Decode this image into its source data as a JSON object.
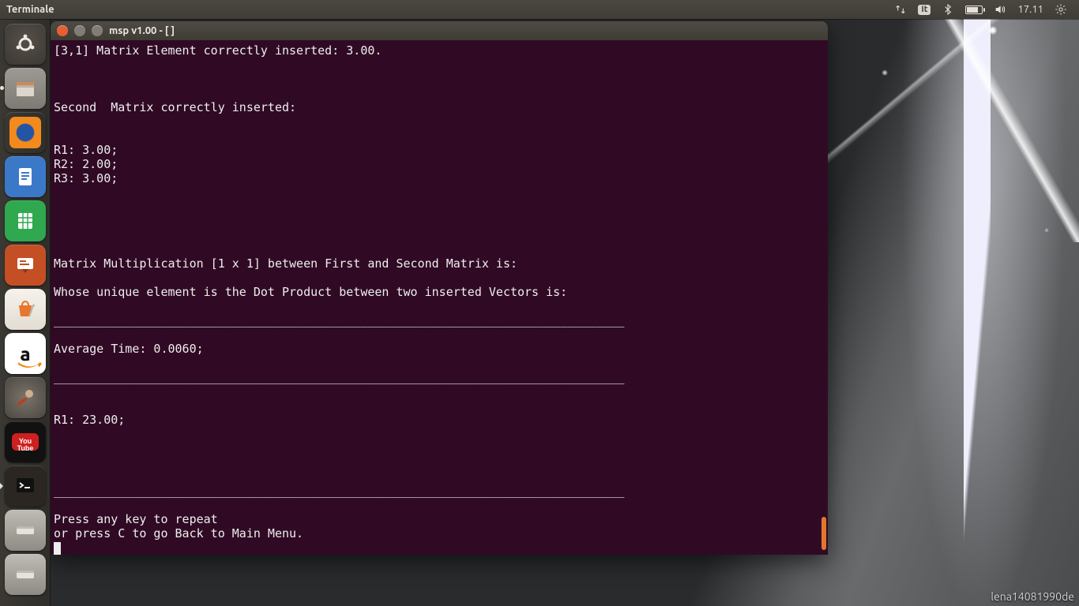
{
  "panel": {
    "app_title": "Terminale",
    "keyboard_layout": "It",
    "clock": "17.11"
  },
  "launcher": {
    "items": [
      {
        "name": "dash",
        "label": "Dash"
      },
      {
        "name": "files",
        "label": "Files",
        "running": true,
        "pips": 1
      },
      {
        "name": "firefox",
        "label": "Firefox"
      },
      {
        "name": "writer",
        "label": "LibreOffice Writer"
      },
      {
        "name": "calc",
        "label": "LibreOffice Calc"
      },
      {
        "name": "impress",
        "label": "LibreOffice Impress"
      },
      {
        "name": "software",
        "label": "Ubuntu Software"
      },
      {
        "name": "amazon",
        "label": "Amazon"
      },
      {
        "name": "settings",
        "label": "System Settings"
      },
      {
        "name": "youtube",
        "label": "YouTube"
      },
      {
        "name": "terminal",
        "label": "Terminal",
        "running": true,
        "active": true
      },
      {
        "name": "drive1",
        "label": "Mounted drive"
      },
      {
        "name": "drive2",
        "label": "Mounted drive"
      }
    ]
  },
  "window": {
    "title": "msp v1.00 - [ ]"
  },
  "terminal": {
    "lines": [
      "[3,1] Matrix Element correctly inserted: 3.00.",
      "",
      "",
      "",
      "Second  Matrix correctly inserted:",
      "",
      "",
      "R1: 3.00;",
      "R2: 2.00;",
      "R3: 3.00;",
      "",
      "",
      "",
      "",
      "",
      "Matrix Multiplication [1 x 1] between First and Second Matrix is:",
      "",
      "Whose unique element is the Dot Product between two inserted Vectors is:",
      "",
      "________________________________________________________________________________",
      "",
      "Average Time: 0.0060;",
      "",
      "________________________________________________________________________________",
      "",
      "",
      "R1: 23.00;",
      "",
      "",
      "",
      "",
      "________________________________________________________________________________",
      "",
      "Press any key to repeat",
      "or press C to go Back to Main Menu."
    ]
  },
  "watermark": "lena14081990de"
}
